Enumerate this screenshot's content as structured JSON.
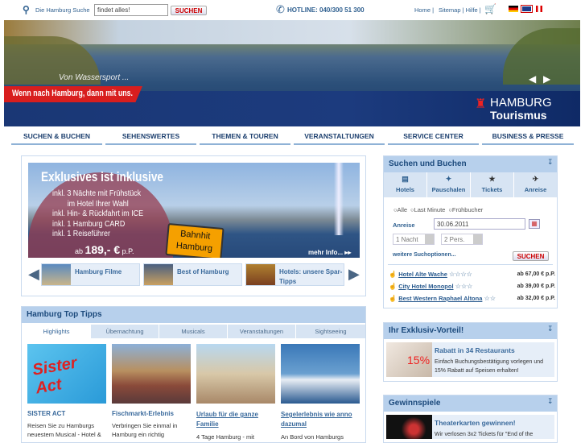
{
  "topbar": {
    "search_label": "Die Hamburg Suche",
    "search_value": "findet alles!",
    "search_button": "SUCHEN",
    "hotline": "HOTLINE: 040/300 51 300",
    "links": [
      "Home |",
      "Sitemap | Hilfe |"
    ]
  },
  "banner": {
    "caption": "Von Wassersport ...",
    "slogan": "Wenn nach Hamburg, dann mit uns.",
    "logo_line1": "HAMBURG",
    "logo_line2": "Tourismus"
  },
  "nav": [
    "SUCHEN & BUCHEN",
    "SEHENSWERTES",
    "THEMEN & TOUREN",
    "VERANSTALTUNGEN",
    "SERVICE CENTER",
    "BUSINESS & PRESSE"
  ],
  "promo": {
    "title": "Exklusives ist inklusive",
    "lines": [
      "inkl. 3 Nächte mit Frühstück",
      "im Hotel Ihrer Wahl",
      "inkl. Hin- & Rückfahrt im ICE",
      "inkl. 1 Hamburg CARD",
      "inkl. 1 Reiseführer"
    ],
    "price_prefix": "ab",
    "price": "189,- €",
    "price_suffix": "p.P.",
    "sign_line1": "Bahnhit",
    "sign_line2": "Hamburg",
    "more": "mehr Info...",
    "thumbs": [
      "Hamburg Filme",
      "Best of Hamburg",
      "Hotels: unsere Spar-Tipps"
    ]
  },
  "tipps": {
    "title": "Hamburg Top Tipps",
    "tabs": [
      "Highlights",
      "Übernachtung",
      "Musicals",
      "Veranstaltungen",
      "Sightseeing"
    ],
    "items": [
      {
        "title": "SISTER ACT",
        "text": "Reisen Sie zu Hamburgs neuestem Musical - Hotel &"
      },
      {
        "title": "Fischmarkt-Erlebnis",
        "text": "Verbringen Sie einmal in Hamburg ein richtig"
      },
      {
        "title": "Urlaub für die ganze Familie",
        "text": "4 Tage Hamburg - mit"
      },
      {
        "title": "Segelerlebnis wie anno dazumal",
        "text": "An Bord von Hamburgs"
      }
    ]
  },
  "booking": {
    "title": "Suchen und Buchen",
    "tabs": [
      "Hotels",
      "Pauschalen",
      "Tickets",
      "Anreise"
    ],
    "radios": [
      "Alle",
      "Last Minute",
      "Frühbucher"
    ],
    "anreise_label": "Anreise",
    "date": "30.06.2011",
    "nights": "1 Nacht",
    "persons": "2 Pers.",
    "more_options": "weitere Suchoptionen...",
    "search_button": "SUCHEN",
    "hotels": [
      {
        "name": "Hotel Alte Wache",
        "stars": "☆☆☆☆",
        "price": "ab 67,00 € p.P."
      },
      {
        "name": "City Hotel Monopol",
        "stars": "☆☆☆",
        "price": "ab 39,00 € p.P."
      },
      {
        "name": "Best Western Raphael Altona",
        "stars": "☆☆",
        "price": "ab 32,00 € p.P."
      }
    ]
  },
  "exklusiv": {
    "title": "Ihr Exklusiv-Vorteil!",
    "badge": "15%",
    "heading": "Rabatt in 34 Restaurants",
    "text": "Einfach Buchungsbestätigung vorlegen und 15% Rabatt auf Speisen erhalten!"
  },
  "gewinn": {
    "title": "Gewinnspiele",
    "heading": "Theaterkarten gewinnen!",
    "text": "Wir verlosen 3x2 Tickets für \"End of the"
  }
}
